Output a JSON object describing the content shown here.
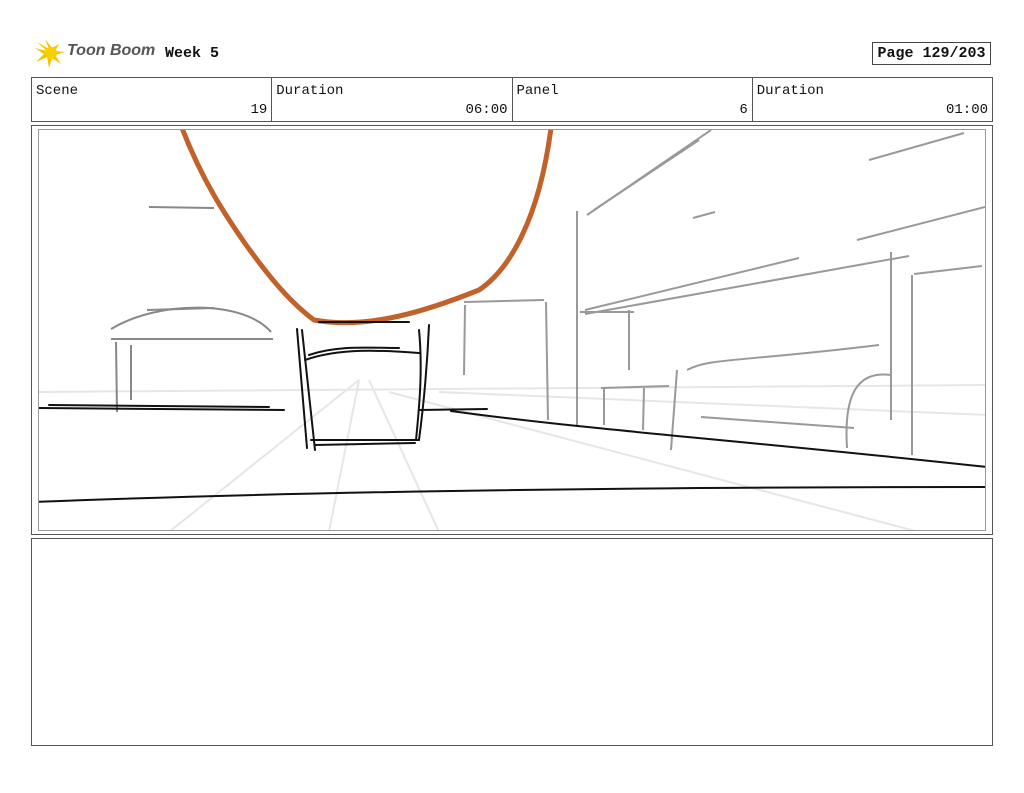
{
  "header": {
    "brand": "Toon Boom",
    "project": "Week 5",
    "page": "Page 129/203"
  },
  "info": [
    {
      "label": "Scene",
      "value": "19"
    },
    {
      "label": "Duration",
      "value": "06:00"
    },
    {
      "label": "Panel",
      "value": "6"
    },
    {
      "label": "Duration",
      "value": "01:00"
    }
  ],
  "colors": {
    "accent_stroke": "#c0622a",
    "logo": "#f5c400"
  },
  "icons": [
    "toon-boom-logo-icon"
  ]
}
